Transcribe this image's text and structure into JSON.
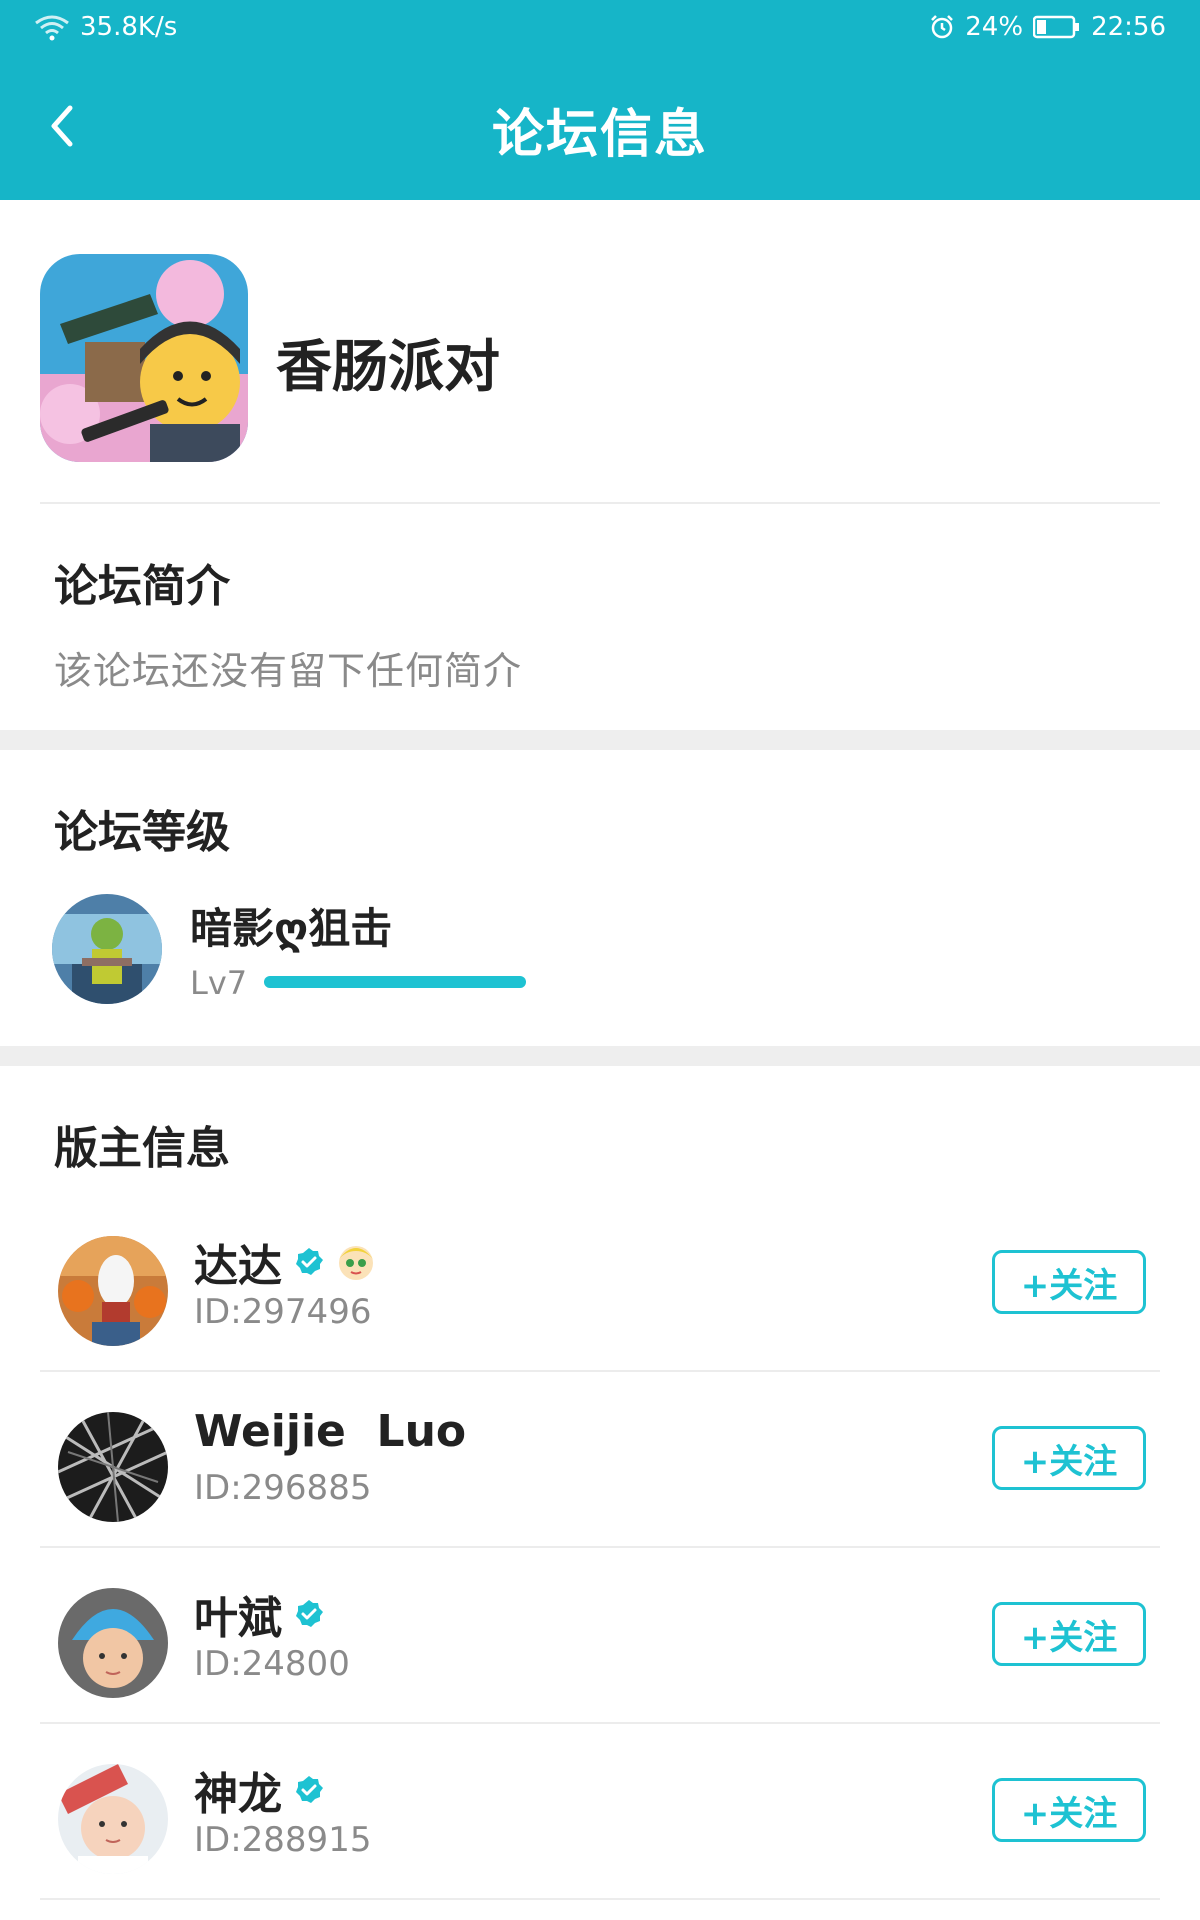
{
  "status_bar": {
    "speed": "35.8K/s",
    "battery": "24%",
    "time": "22:56"
  },
  "header": {
    "title": "论坛信息",
    "back_icon": "chevron-left-icon"
  },
  "forum": {
    "name": "香肠派对"
  },
  "intro": {
    "title": "论坛简介",
    "text": "该论坛还没有留下任何简介"
  },
  "level": {
    "title": "论坛等级",
    "user_name": "暗影ღ狙击",
    "level_label": "Lv7",
    "progress": 1.0
  },
  "moderators": {
    "title": "版主信息",
    "follow_label": "+关注",
    "items": [
      {
        "name": "达达",
        "id": "ID:297496",
        "verified": true,
        "badge": true
      },
      {
        "name": "Weijie  Luo",
        "id": "ID:296885",
        "verified": false,
        "badge": false
      },
      {
        "name": "叶斌",
        "id": "ID:24800",
        "verified": true,
        "badge": false
      },
      {
        "name": "神龙",
        "id": "ID:288915",
        "verified": true,
        "badge": false
      }
    ]
  },
  "colors": {
    "brand": "#16b5c8",
    "accent": "#1ec2d2",
    "text_primary": "#222222",
    "text_secondary": "#8a8a8a"
  }
}
